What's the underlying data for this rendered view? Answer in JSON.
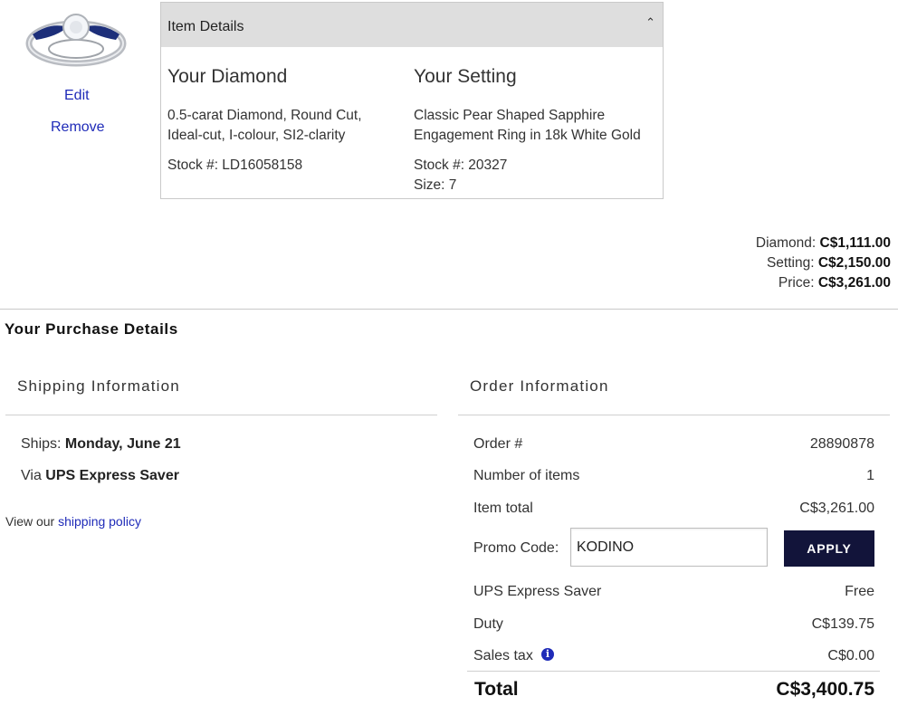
{
  "product": {
    "actions": {
      "edit": "Edit",
      "remove": "Remove"
    }
  },
  "item_details": {
    "header": "Item Details",
    "diamond": {
      "heading": "Your Diamond",
      "description_line1": "0.5-carat Diamond, Round Cut,",
      "description_line2": "Ideal-cut, I-colour, SI2-clarity",
      "stock": "Stock #: LD16058158"
    },
    "setting": {
      "heading": "Your Setting",
      "description_line1": "Classic Pear Shaped Sapphire",
      "description_line2": "Engagement Ring in 18k White Gold",
      "stock": "Stock #: 20327",
      "size": "Size: 7"
    }
  },
  "price_summary": {
    "diamond_label": "Diamond:",
    "diamond_value": "C$1,111.00",
    "setting_label": "Setting:",
    "setting_value": "C$2,150.00",
    "price_label": "Price:",
    "price_value": "C$3,261.00"
  },
  "purchase": {
    "title": "Your Purchase Details",
    "shipping": {
      "heading": "Shipping Information",
      "ships_label": "Ships:",
      "ships_date": "Monday, June 21",
      "via_label": "Via",
      "carrier": "UPS Express Saver",
      "policy_prefix": "View our",
      "policy_link": "shipping policy"
    },
    "order": {
      "heading": "Order Information",
      "order_no_label": "Order #",
      "order_no": "28890878",
      "items_label": "Number of items",
      "items": "1",
      "item_total_label": "Item total",
      "item_total": "C$3,261.00",
      "promo_label": "Promo Code:",
      "promo_value": "KODINO",
      "apply": "APPLY",
      "shipping_label": "UPS Express Saver",
      "shipping_value": "Free",
      "duty_label": "Duty",
      "duty_value": "C$139.75",
      "tax_label": "Sales tax",
      "tax_value": "C$0.00",
      "total_label": "Total",
      "total_value": "C$3,400.75"
    }
  },
  "colors": {
    "link": "#1f2bb8",
    "button": "#12143a",
    "header_bg": "#dedede"
  }
}
